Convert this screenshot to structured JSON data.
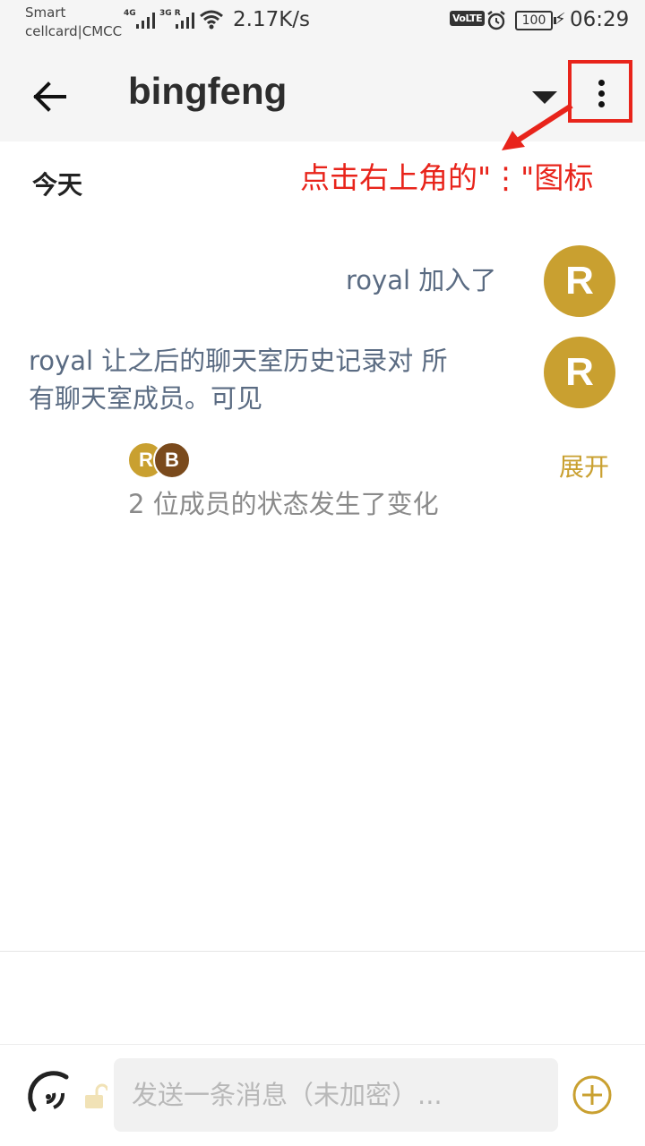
{
  "status_bar": {
    "carrier_line1": "Smart",
    "carrier_line2": "cellcard|CMCC",
    "net1": "4G",
    "net2": "3G R",
    "speed": "2.17K/s",
    "volte": "VoLTE",
    "battery": "100",
    "time": "06:29"
  },
  "header": {
    "title": "bingfeng",
    "back_icon": "arrow-left-icon",
    "dropdown_icon": "caret-down-icon",
    "more_icon": "more-vertical-icon"
  },
  "annotation": {
    "text": "点击右上角的\"⋮\"图标",
    "color": "#e8241b"
  },
  "timeline": {
    "date_separator": "今天",
    "events": [
      {
        "text": "royal 加入了",
        "avatar_letter": "R"
      },
      {
        "text_line1": "royal 让之后的聊天室历史记录对 所",
        "text_line2": "有聊天室成员。可见",
        "avatar_letter": "R"
      }
    ],
    "summary": {
      "avatars": [
        {
          "letter": "R",
          "color": "#c9a030"
        },
        {
          "letter": "B",
          "color": "#7a4a1c"
        }
      ],
      "expand_label": "展开",
      "text": "2 位成员的状态发生了变化"
    }
  },
  "composer": {
    "placeholder": "发送一条消息（未加密）...",
    "voice_icon": "voice-icon",
    "lock_icon": "unlock-icon",
    "add_icon": "plus-circle-icon"
  },
  "colors": {
    "accent": "#c9a030",
    "secondary_avatar": "#7a4a1c",
    "highlight": "#e8241b"
  }
}
